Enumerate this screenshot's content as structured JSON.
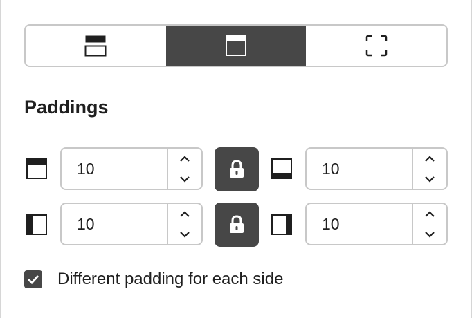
{
  "layout_tabs": [
    {
      "icon": "border-top-icon",
      "active": false
    },
    {
      "icon": "padding-top-icon",
      "active": true
    },
    {
      "icon": "margin-corners-icon",
      "active": false
    }
  ],
  "paddings": {
    "heading": "Paddings",
    "top": {
      "icon": "padding-top-side-icon",
      "value": "10"
    },
    "bottom": {
      "icon": "padding-bottom-side-icon",
      "value": "10"
    },
    "left": {
      "icon": "padding-left-side-icon",
      "value": "10"
    },
    "right": {
      "icon": "padding-right-side-icon",
      "value": "10"
    },
    "lock_icon": "lock-icon",
    "different_sides": {
      "label": "Different padding for each side",
      "checked": true
    }
  },
  "colors": {
    "accent_dark": "#474747",
    "border": "#c8c8c8",
    "text": "#1f1f1f"
  }
}
